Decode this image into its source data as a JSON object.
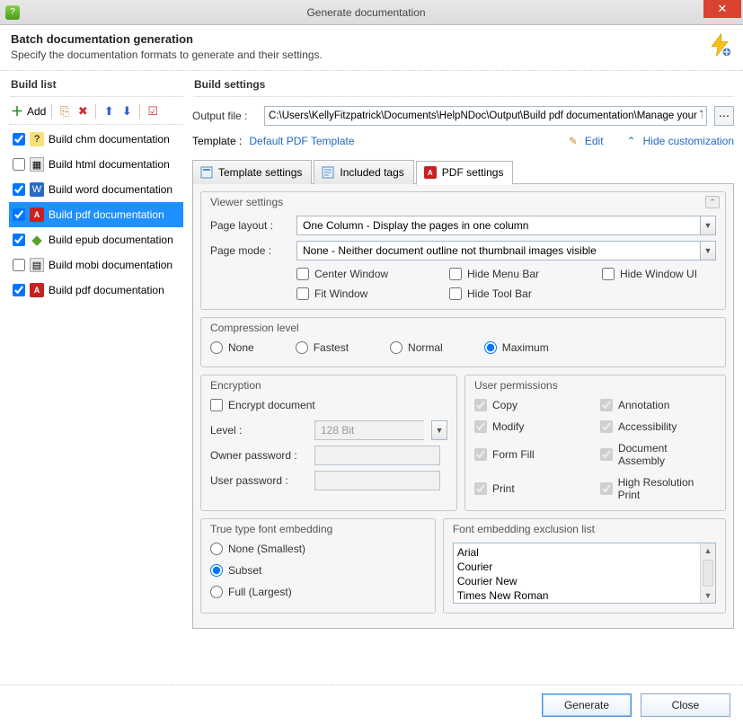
{
  "window": {
    "title": "Generate documentation"
  },
  "header": {
    "title": "Batch documentation generation",
    "subtitle": "Specify the documentation formats to generate and their settings."
  },
  "buildlist": {
    "title": "Build list",
    "add": "Add",
    "items": [
      {
        "label": "Build chm documentation",
        "checked": true,
        "icon": "chm"
      },
      {
        "label": "Build html documentation",
        "checked": false,
        "icon": "html"
      },
      {
        "label": "Build word documentation",
        "checked": true,
        "icon": "word"
      },
      {
        "label": "Build pdf documentation",
        "checked": true,
        "icon": "pdf",
        "selected": true
      },
      {
        "label": "Build epub documentation",
        "checked": true,
        "icon": "epub"
      },
      {
        "label": "Build mobi documentation",
        "checked": false,
        "icon": "mobi"
      },
      {
        "label": "Build pdf documentation",
        "checked": true,
        "icon": "pdf"
      }
    ]
  },
  "buildsettings": {
    "title": "Build settings",
    "output_label": "Output file :",
    "output_value": "C:\\Users\\KellyFitzpatrick\\Documents\\HelpNDoc\\Output\\Build pdf documentation\\Manage your Table of C",
    "template_label": "Template :",
    "template_value": "Default PDF Template",
    "edit": "Edit",
    "hide": "Hide customization"
  },
  "tabs": {
    "t1": "Template settings",
    "t2": "Included tags",
    "t3": "PDF settings"
  },
  "viewer": {
    "legend": "Viewer settings",
    "page_layout_label": "Page layout :",
    "page_layout_value": "One Column - Display the pages in one column",
    "page_mode_label": "Page mode :",
    "page_mode_value": "None - Neither document outline not thumbnail images visible",
    "checks": {
      "center": "Center Window",
      "fit": "Fit Window",
      "menu": "Hide Menu Bar",
      "tool": "Hide Tool Bar",
      "ui": "Hide Window UI"
    }
  },
  "compression": {
    "legend": "Compression level",
    "none": "None",
    "fastest": "Fastest",
    "normal": "Normal",
    "max": "Maximum"
  },
  "encryption": {
    "legend": "Encryption",
    "encrypt": "Encrypt document",
    "level_label": "Level :",
    "level_value": "128 Bit",
    "owner_label": "Owner password :",
    "user_label": "User password :"
  },
  "permissions": {
    "legend": "User permissions",
    "copy": "Copy",
    "modify": "Modify",
    "form": "Form Fill",
    "print": "Print",
    "annotation": "Annotation",
    "accessibility": "Accessibility",
    "assembly": "Document Assembly",
    "hires": "High Resolution Print"
  },
  "embedding": {
    "legend": "True type font embedding",
    "none": "None (Smallest)",
    "subset": "Subset",
    "full": "Full (Largest)"
  },
  "exclusion": {
    "legend": "Font embedding exclusion list",
    "items": [
      "Arial",
      "Courier",
      "Courier New",
      "Times New Roman"
    ]
  },
  "footer": {
    "generate": "Generate",
    "close": "Close"
  }
}
